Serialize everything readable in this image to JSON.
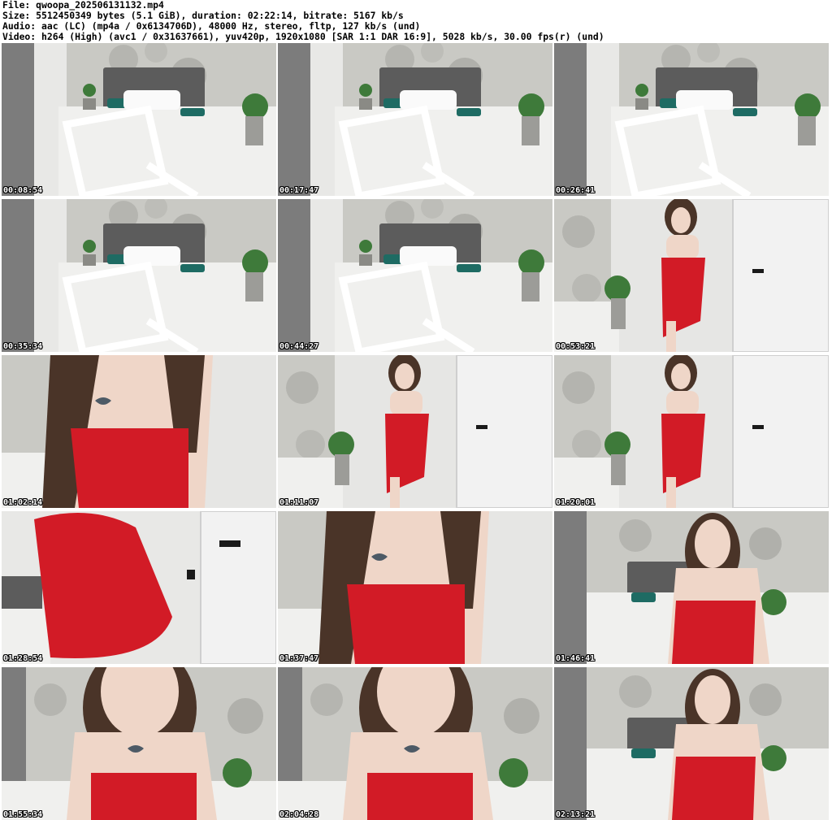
{
  "header": {
    "line1": "File: qwoopa_202506131132.mp4",
    "line2": "Size: 5512450349 bytes (5.1 GiB), duration: 02:22:14, bitrate: 5167 kb/s",
    "line3": "Audio: aac (LC) (mp4a / 0x6134706D), 48000 Hz, stereo, fltp, 127 kb/s (und)",
    "line4": "Video: h264 (High) (avc1 / 0x31637661), yuv420p, 1920x1080 [SAR 1:1 DAR 16:9], 5028 kb/s, 30.00 fps(r) (und)"
  },
  "colors": {
    "wall": "#c9c9c4",
    "bed": "#f0f0ee",
    "headboard": "#5c5c5c",
    "dress": "#d21b26",
    "skin": "#efd6c8",
    "hair": "#4a3428",
    "door": "#f2f2f2",
    "pillow": "#1e6b63",
    "plant": "#3e7a3a",
    "curtain": "#7c7c7c"
  },
  "thumbnails": [
    {
      "timestamp": "00:08:54",
      "scene": "room"
    },
    {
      "timestamp": "00:17:47",
      "scene": "room"
    },
    {
      "timestamp": "00:26:41",
      "scene": "room"
    },
    {
      "timestamp": "00:35:34",
      "scene": "room"
    },
    {
      "timestamp": "00:44:27",
      "scene": "room"
    },
    {
      "timestamp": "00:53:21",
      "scene": "door-person"
    },
    {
      "timestamp": "01:02:14",
      "scene": "closeup-torso"
    },
    {
      "timestamp": "01:11:07",
      "scene": "door-person"
    },
    {
      "timestamp": "01:20:01",
      "scene": "door-person"
    },
    {
      "timestamp": "01:28:54",
      "scene": "closeup-dress"
    },
    {
      "timestamp": "01:37:47",
      "scene": "closeup-torso"
    },
    {
      "timestamp": "01:46:41",
      "scene": "bed-person"
    },
    {
      "timestamp": "01:55:34",
      "scene": "face-closeup"
    },
    {
      "timestamp": "02:04:28",
      "scene": "face-closeup"
    },
    {
      "timestamp": "02:13:21",
      "scene": "bed-person"
    }
  ]
}
